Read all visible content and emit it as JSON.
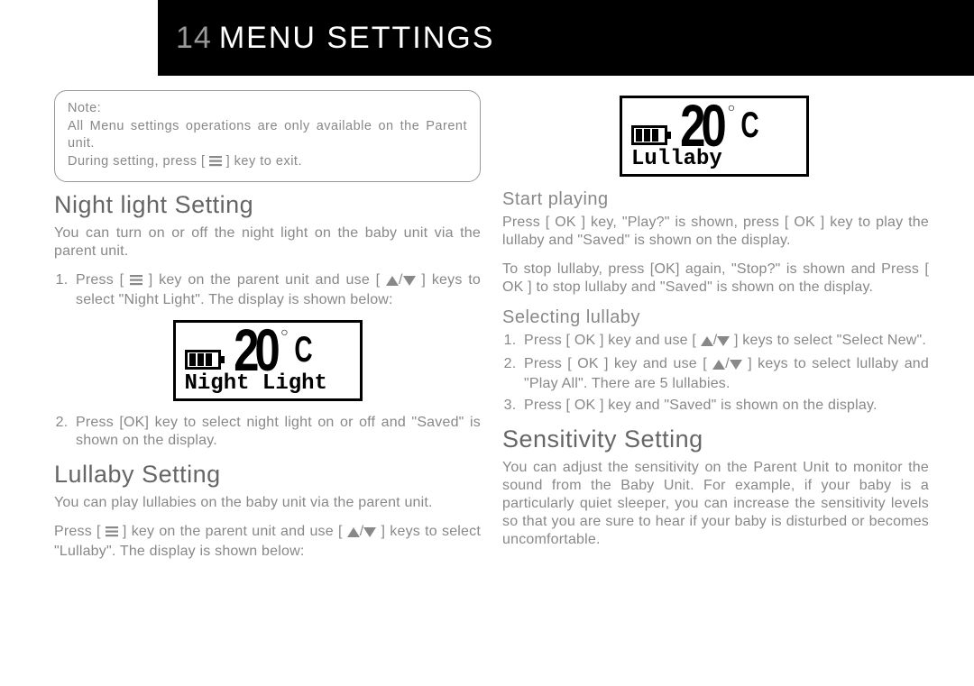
{
  "header": {
    "page_number": "14",
    "title": "MENU SETTINGS"
  },
  "note": {
    "label": "Note:",
    "line1": "All Menu settings operations are only available on the Parent unit.",
    "line2_a": "During setting, press [ ",
    "line2_b": " ] key to exit."
  },
  "left": {
    "nightlight": {
      "heading": "Night light Setting",
      "intro": "You can turn on or off the night light on the baby unit via the parent unit.",
      "step1_a": "Press [ ",
      "step1_b": " ] key on the parent unit and use [ ",
      "step1_c": " ] keys to select \"Night Light\". The display is shown below:",
      "lcd_label": "Night Light",
      "lcd_temp": "20",
      "lcd_unit": "C",
      "step2": "Press [OK] key to select night light on or off and \"Saved\" is shown on the display."
    },
    "lullaby": {
      "heading": "Lullaby Setting",
      "intro": "You can play lullabies on the baby unit via the parent unit.",
      "p2_a": "Press [ ",
      "p2_b": " ] key on the parent unit and use [ ",
      "p2_c": " ] keys to select \"Lullaby\". The display is shown below:"
    }
  },
  "right": {
    "lcd_label": "Lullaby",
    "lcd_temp": "20",
    "lcd_unit": "C",
    "start": {
      "heading": "Start playing",
      "p1": "Press [ OK ] key, \"Play?\" is shown, press [ OK ] key to play the lullaby and \"Saved\" is shown on the display.",
      "p2": "To stop lullaby, press [OK] again, \"Stop?\" is shown and Press [ OK ] to stop lullaby and \"Saved\" is shown on the display."
    },
    "select": {
      "heading": "Selecting lullaby",
      "s1_a": "Press [ OK ] key and use [ ",
      "s1_b": " ] keys to select \"Select New\".",
      "s2_a": "Press [ OK ] key and use [ ",
      "s2_b": " ] keys to select lullaby and \"Play All\". There are 5 lullabies.",
      "s3": "Press [ OK ] key and \"Saved\" is shown on the display."
    },
    "sensitivity": {
      "heading": "Sensitivity Setting",
      "p1": "You can adjust the sensitivity on the Parent Unit to monitor the sound from the Baby Unit. For example, if your baby is a particularly quiet sleeper, you can increase the sensitivity levels so that you are sure to hear if your baby is disturbed or becomes uncomfortable."
    }
  }
}
